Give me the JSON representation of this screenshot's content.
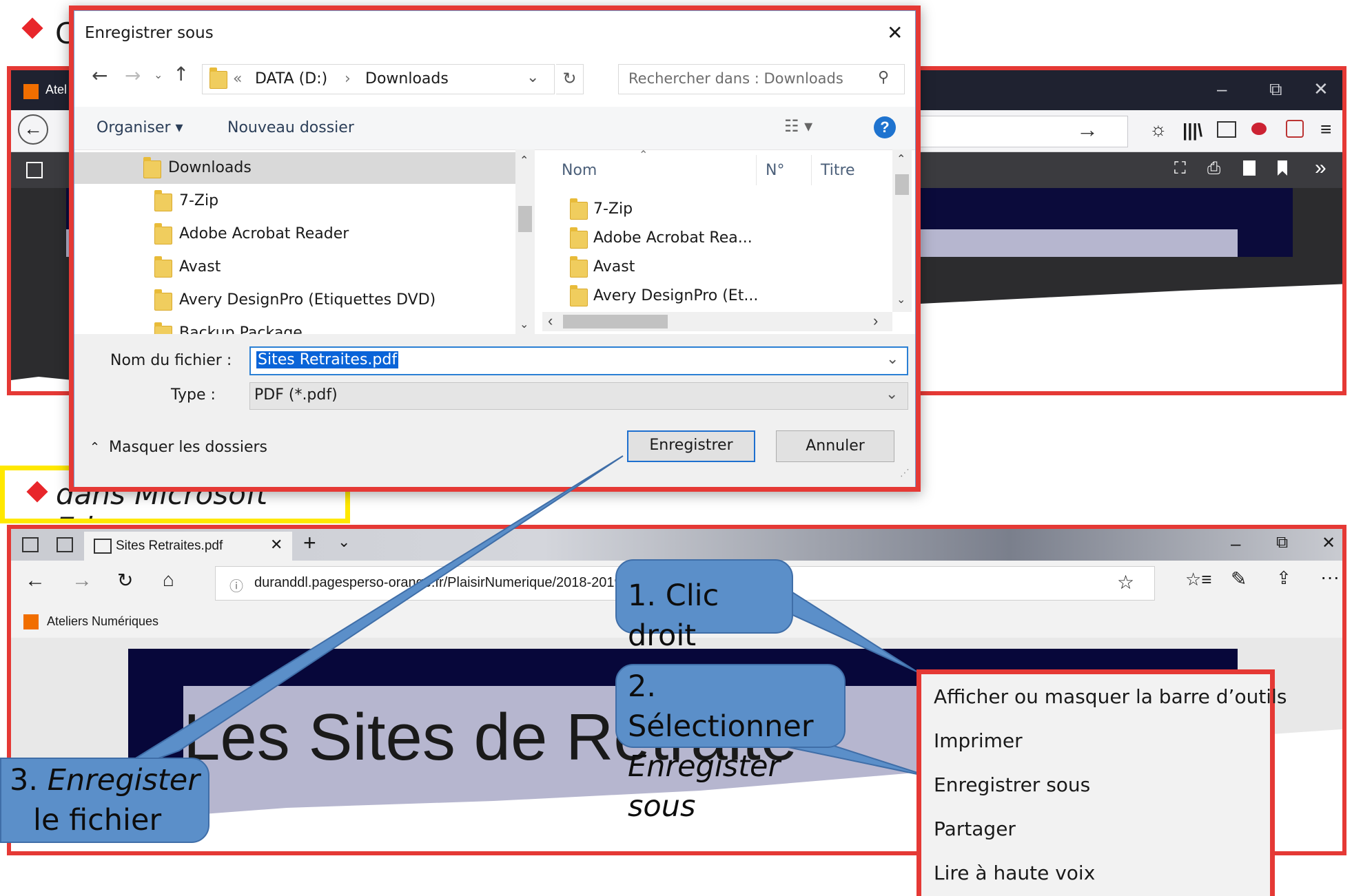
{
  "header": {
    "line1_initial": "C"
  },
  "firefox": {
    "tab_title": "Atel",
    "controls": {
      "minimize": "–",
      "restore": "⧉",
      "close": "✕"
    }
  },
  "dialog": {
    "title": "Enregistrer sous",
    "close": "✕",
    "breadcrumb": {
      "prefix": "«",
      "drive": "DATA (D:)",
      "sep": "›",
      "folder": "Downloads"
    },
    "search_placeholder": "Rechercher dans : Downloads",
    "toolbar": {
      "organize": "Organiser ▾",
      "new_folder": "Nouveau dossier",
      "help": "?"
    },
    "tree": [
      "Downloads",
      "7-Zip",
      "Adobe Acrobat Reader",
      "Avast",
      "Avery DesignPro (Etiquettes DVD)",
      "Backup Package"
    ],
    "columns": {
      "name": "Nom",
      "number": "N°",
      "title": "Titre"
    },
    "files": [
      "7-Zip",
      "Adobe Acrobat Rea...",
      "Avast",
      "Avery DesignPro (Et..."
    ],
    "filename_label": "Nom du fichier :",
    "filename_value": "Sites Retraites.pdf",
    "type_label": "Type :",
    "type_value": "PDF (*.pdf)",
    "hide_folders": "Masquer les dossiers",
    "save_button": "Enregistrer",
    "cancel_button": "Annuler"
  },
  "edge_heading": "dans Microsoft Edge",
  "edge": {
    "tab_title": "Sites Retraites.pdf",
    "new_tab": "+",
    "address": "duranddl.pagesperso-orange.fr/PlaisirNumerique/2018-2019",
    "favorite": "Ateliers Numériques",
    "controls": {
      "minimize": "–",
      "restore": "⧉",
      "close": "✕"
    },
    "more": "···",
    "page_title_text": "Les Sites de Retraite"
  },
  "callouts": {
    "step1": "1. Clic droit",
    "step2_line1": "2. Sélectionner",
    "step2_line2": "Enregister sous",
    "step3_prefix": "3. ",
    "step3_italic": "Enregister",
    "step3_line2": "le fichier"
  },
  "context_menu": [
    "Afficher ou masquer la barre d’outils",
    "Imprimer",
    "Enregistrer sous",
    "Partager",
    "Lire à haute voix"
  ],
  "colors": {
    "frame_red": "#e53935",
    "heading_yellow": "#ffe800",
    "callout_blue": "#5b8fc9",
    "bullet_red": "#e8262b"
  }
}
